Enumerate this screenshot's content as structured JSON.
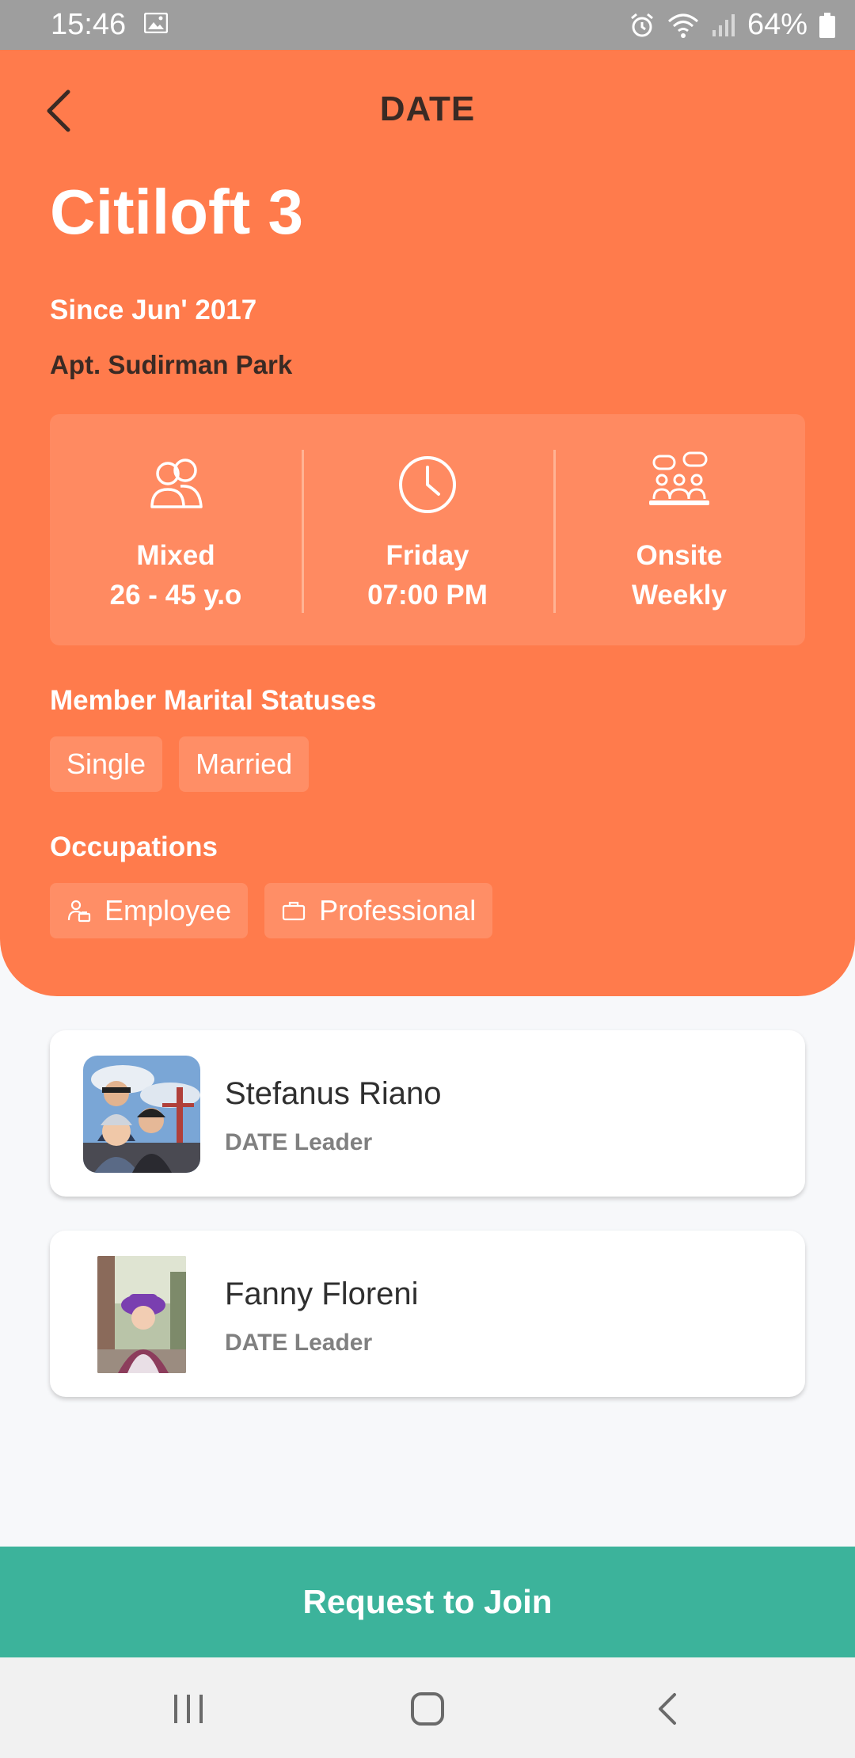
{
  "status_bar": {
    "time": "15:46",
    "battery": "64%"
  },
  "header": {
    "title": "DATE"
  },
  "group": {
    "name": "Citiloft 3",
    "since": "Since Jun' 2017",
    "location": "Apt. Sudirman Park"
  },
  "info": [
    {
      "icon": "people-icon",
      "line1": "Mixed",
      "line2": "26 - 45 y.o"
    },
    {
      "icon": "clock-icon",
      "line1": "Friday",
      "line2": "07:00 PM"
    },
    {
      "icon": "meeting-icon",
      "line1": "Onsite",
      "line2": "Weekly"
    }
  ],
  "marital": {
    "label": "Member Marital Statuses",
    "items": [
      "Single",
      "Married"
    ]
  },
  "occupations": {
    "label": "Occupations",
    "items": [
      {
        "icon": "employee-icon",
        "label": "Employee"
      },
      {
        "icon": "briefcase-icon",
        "label": "Professional"
      }
    ]
  },
  "leaders": [
    {
      "name": "Stefanus Riano",
      "role": "DATE Leader"
    },
    {
      "name": "Fanny Floreni",
      "role": "DATE Leader"
    }
  ],
  "cta": {
    "label": "Request to Join"
  },
  "colors": {
    "accent": "#ff7b4c",
    "cta": "#3cb39b"
  }
}
